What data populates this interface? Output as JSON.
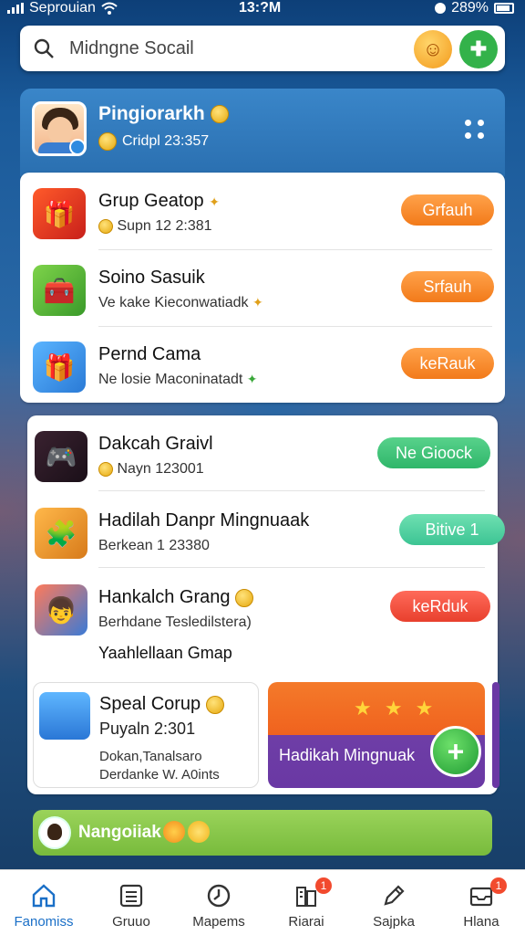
{
  "status_bar": {
    "carrier": "Seprouian",
    "time": "13:?M",
    "battery": "289%"
  },
  "search": {
    "placeholder": "Midngne Socail"
  },
  "profile": {
    "name": "Pingiorarkh",
    "subtitle": "Cridpl 23:357"
  },
  "list_one": [
    {
      "title": "Grup Geatop",
      "subtitle": "Supn 12 2:381",
      "button": "Grfauh",
      "button_color": "#f58a2c"
    },
    {
      "title": "Soino Sasuik",
      "subtitle": "Ve kake Kieconwatiadk",
      "button": "Srfauh",
      "button_color": "#f58a2c"
    },
    {
      "title": "Pernd Cama",
      "subtitle": "Ne losie Maconinatadt",
      "button": "keRauk",
      "button_color": "#f58a2c"
    }
  ],
  "list_two": [
    {
      "title": "Dakcah Graivl",
      "subtitle": "Nayn 123001",
      "button": "Ne Gioock",
      "button_color": "#3cc47a"
    },
    {
      "title": "Hadilah Danpr Mingnuaak",
      "subtitle": "Berkean 1 23380",
      "button": "Bitive 1",
      "button_color": "#5fd8a8"
    },
    {
      "title": "Hankalch Grang",
      "subtitle": "Berhdane Tesledilstera)",
      "button": "keRduk",
      "button_color": "#ea4a35"
    }
  ],
  "free_text": "Yaahlellaan Gmap",
  "promo_left": {
    "title": "Speal Corup",
    "subtitle": "Puyaln 2:301",
    "line1": "Dokan,Tanalsaro",
    "line2": "Derdanke W. A0ints"
  },
  "promo_right": {
    "label": "Hadikah Mingnuak",
    "stars": "★ ★ ★"
  },
  "banner": {
    "text": "Nangoiiak"
  },
  "nav": [
    {
      "label": "Fanomiss",
      "icon": "home-icon",
      "badge": ""
    },
    {
      "label": "Gruuo",
      "icon": "list-icon",
      "badge": ""
    },
    {
      "label": "Mapems",
      "icon": "clock-icon",
      "badge": ""
    },
    {
      "label": "Riarai",
      "icon": "building-icon",
      "badge": "1"
    },
    {
      "label": "Sajpka",
      "icon": "pen-icon",
      "badge": ""
    },
    {
      "label": "Hlana",
      "icon": "inbox-icon",
      "badge": "1"
    }
  ],
  "colors": {
    "header_blue": "#2f78bd",
    "accent_orange": "#f58a2c",
    "accent_green": "#3cc47a"
  }
}
